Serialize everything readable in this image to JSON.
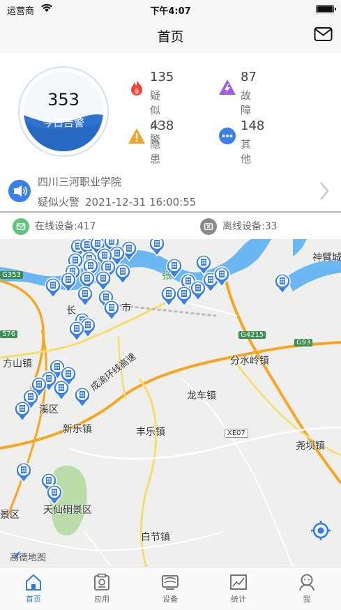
{
  "status_bar": {
    "carrier": "运营商",
    "time": "下午4:07"
  },
  "nav": {
    "title": "首页"
  },
  "summary": {
    "today_count": "353",
    "today_label": "今日告警",
    "stats": [
      {
        "value": "135",
        "name": "疑似火警",
        "icon": "fire-icon",
        "color": "#e8473f"
      },
      {
        "value": "87",
        "name": "故障",
        "icon": "fault-bolt-icon",
        "color": "#a35be0"
      },
      {
        "value": "438",
        "name": "隐患",
        "icon": "warning-triangle-icon",
        "color": "#f0a32a"
      },
      {
        "value": "148",
        "name": "其他",
        "icon": "more-dots-icon",
        "color": "#3b7fe8"
      }
    ]
  },
  "notice": {
    "location": "四川三河职业学院",
    "alarm_type": "疑似火警",
    "timestamp": "2021-12-31 16:00:55"
  },
  "devices": {
    "online": "在线设备:417",
    "offline": "离线设备:33"
  },
  "map": {
    "labels": {
      "shenbi": "神臂城",
      "zhang": "张",
      "shi": "市",
      "chang": "长",
      "fangshan": "方山镇",
      "fenshuiling": "分水岭镇",
      "longche": "龙车镇",
      "xinle": "新乐镇",
      "fengle": "丰乐镇",
      "yaoba": "尧坝镇",
      "qiqu": "溪区",
      "tianxian": "天仙硐景区",
      "baijie": "白节镇",
      "jingqu": "景区",
      "expressway": "成渝环线高速"
    },
    "roads": [
      "G353",
      "G4215",
      "G93",
      "XE07",
      "576"
    ],
    "watermark": "高德地图",
    "marker_count": "markers"
  },
  "tabs": [
    {
      "label": "首页",
      "icon": "home-icon",
      "active": true
    },
    {
      "label": "应用",
      "icon": "apps-icon",
      "active": false
    },
    {
      "label": "设备",
      "icon": "device-icon",
      "active": false
    },
    {
      "label": "统计",
      "icon": "chart-icon",
      "active": false
    },
    {
      "label": "我",
      "icon": "profile-icon",
      "active": false
    }
  ],
  "colors": {
    "accent": "#2f7de1",
    "wave": "#2f73cf",
    "river": "#6bb7f2"
  }
}
